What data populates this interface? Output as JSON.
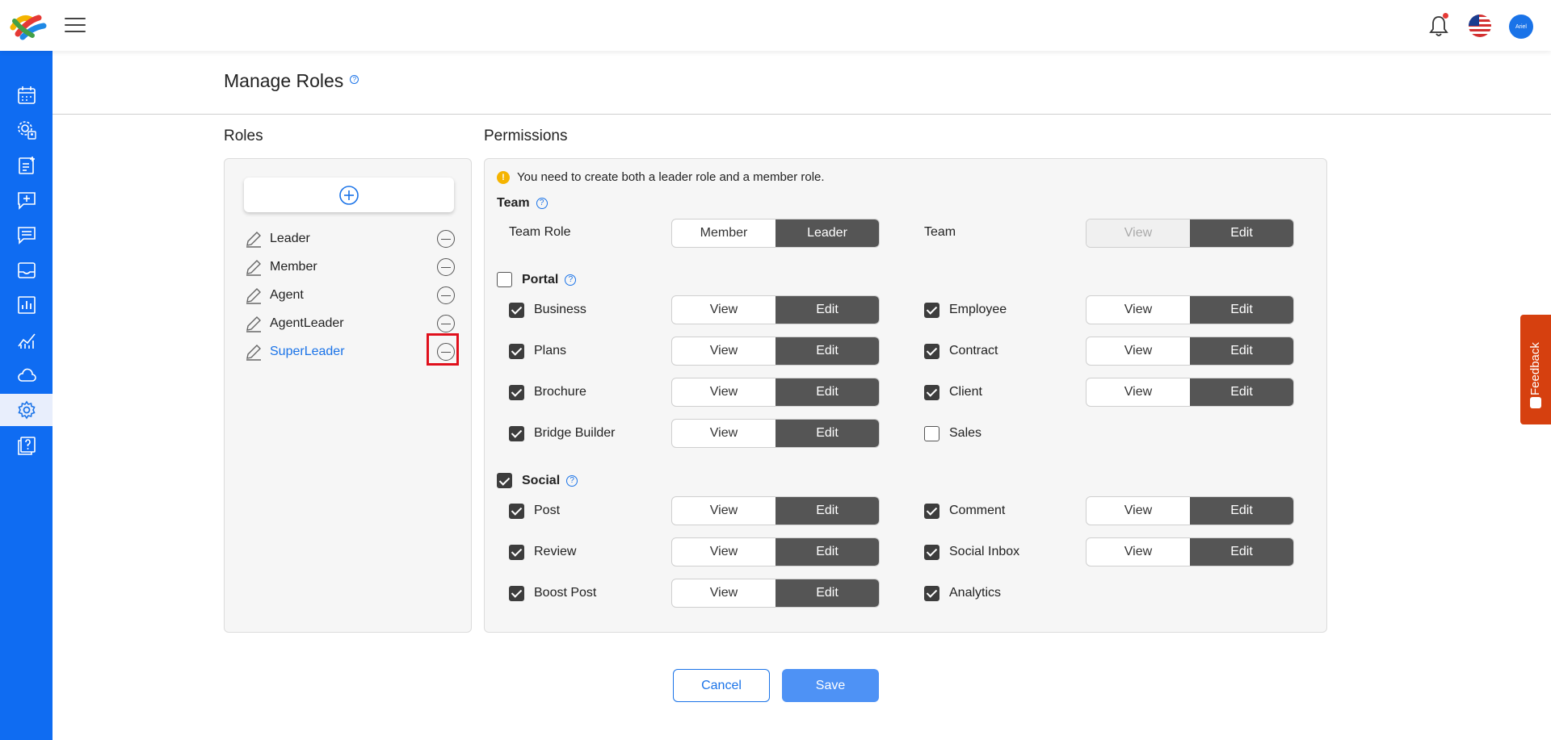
{
  "header": {
    "avatar_text": "Ariel",
    "notification_dot_color": "#e53935"
  },
  "sidebar": {
    "items": [
      {
        "icon": "calendar-icon"
      },
      {
        "icon": "settings-user-icon"
      },
      {
        "icon": "add-note-icon"
      },
      {
        "icon": "add-message-icon"
      },
      {
        "icon": "chat-lines-icon"
      },
      {
        "icon": "inbox-icon"
      },
      {
        "icon": "report-icon"
      },
      {
        "icon": "analytics-icon"
      },
      {
        "icon": "cloud-icon"
      },
      {
        "icon": "gear-icon",
        "active": true
      },
      {
        "icon": "help-book-icon"
      }
    ]
  },
  "page": {
    "title": "Manage Roles",
    "roles_heading": "Roles",
    "permissions_heading": "Permissions"
  },
  "roles": [
    {
      "name": "Leader"
    },
    {
      "name": "Member"
    },
    {
      "name": "Agent"
    },
    {
      "name": "AgentLeader"
    },
    {
      "name": "SuperLeader",
      "selected": true
    }
  ],
  "permissions": {
    "notice": "You need to create both a leader role and a member role.",
    "team": {
      "title": "Team",
      "team_role_label": "Team Role",
      "team_role_options": [
        "Member",
        "Leader"
      ],
      "team_role_selected": "Leader",
      "team_label": "Team",
      "team_options": [
        "View",
        "Edit"
      ],
      "team_selected": "Edit"
    },
    "portal": {
      "title": "Portal",
      "checked": false,
      "left": [
        {
          "label": "Business",
          "checked": true,
          "options": [
            "View",
            "Edit"
          ],
          "selected": "Edit"
        },
        {
          "label": "Plans",
          "checked": true,
          "options": [
            "View",
            "Edit"
          ],
          "selected": "Edit"
        },
        {
          "label": "Brochure",
          "checked": true,
          "options": [
            "View",
            "Edit"
          ],
          "selected": "Edit"
        },
        {
          "label": "Bridge Builder",
          "checked": true,
          "options": [
            "View",
            "Edit"
          ],
          "selected": "Edit"
        }
      ],
      "right": [
        {
          "label": "Employee",
          "checked": true,
          "options": [
            "View",
            "Edit"
          ],
          "selected": "Edit"
        },
        {
          "label": "Contract",
          "checked": true,
          "options": [
            "View",
            "Edit"
          ],
          "selected": "Edit"
        },
        {
          "label": "Client",
          "checked": true,
          "options": [
            "View",
            "Edit"
          ],
          "selected": "Edit"
        },
        {
          "label": "Sales",
          "checked": false
        }
      ]
    },
    "social": {
      "title": "Social",
      "checked": true,
      "left": [
        {
          "label": "Post",
          "checked": true,
          "options": [
            "View",
            "Edit"
          ],
          "selected": "Edit"
        },
        {
          "label": "Review",
          "checked": true,
          "options": [
            "View",
            "Edit"
          ],
          "selected": "Edit"
        },
        {
          "label": "Boost Post",
          "checked": true,
          "options": [
            "View",
            "Edit"
          ],
          "selected": "Edit"
        }
      ],
      "right": [
        {
          "label": "Comment",
          "checked": true,
          "options": [
            "View",
            "Edit"
          ],
          "selected": "Edit"
        },
        {
          "label": "Social Inbox",
          "checked": true,
          "options": [
            "View",
            "Edit"
          ],
          "selected": "Edit"
        },
        {
          "label": "Analytics",
          "checked": true
        }
      ]
    }
  },
  "footer": {
    "cancel_label": "Cancel",
    "save_label": "Save"
  },
  "feedback": {
    "label": "Feedback"
  },
  "colors": {
    "sidebar": "#0f6cf2",
    "accent": "#1a73e8",
    "toggle_on": "#555555",
    "feedback": "#d6400f",
    "highlight": "#e0101c"
  }
}
